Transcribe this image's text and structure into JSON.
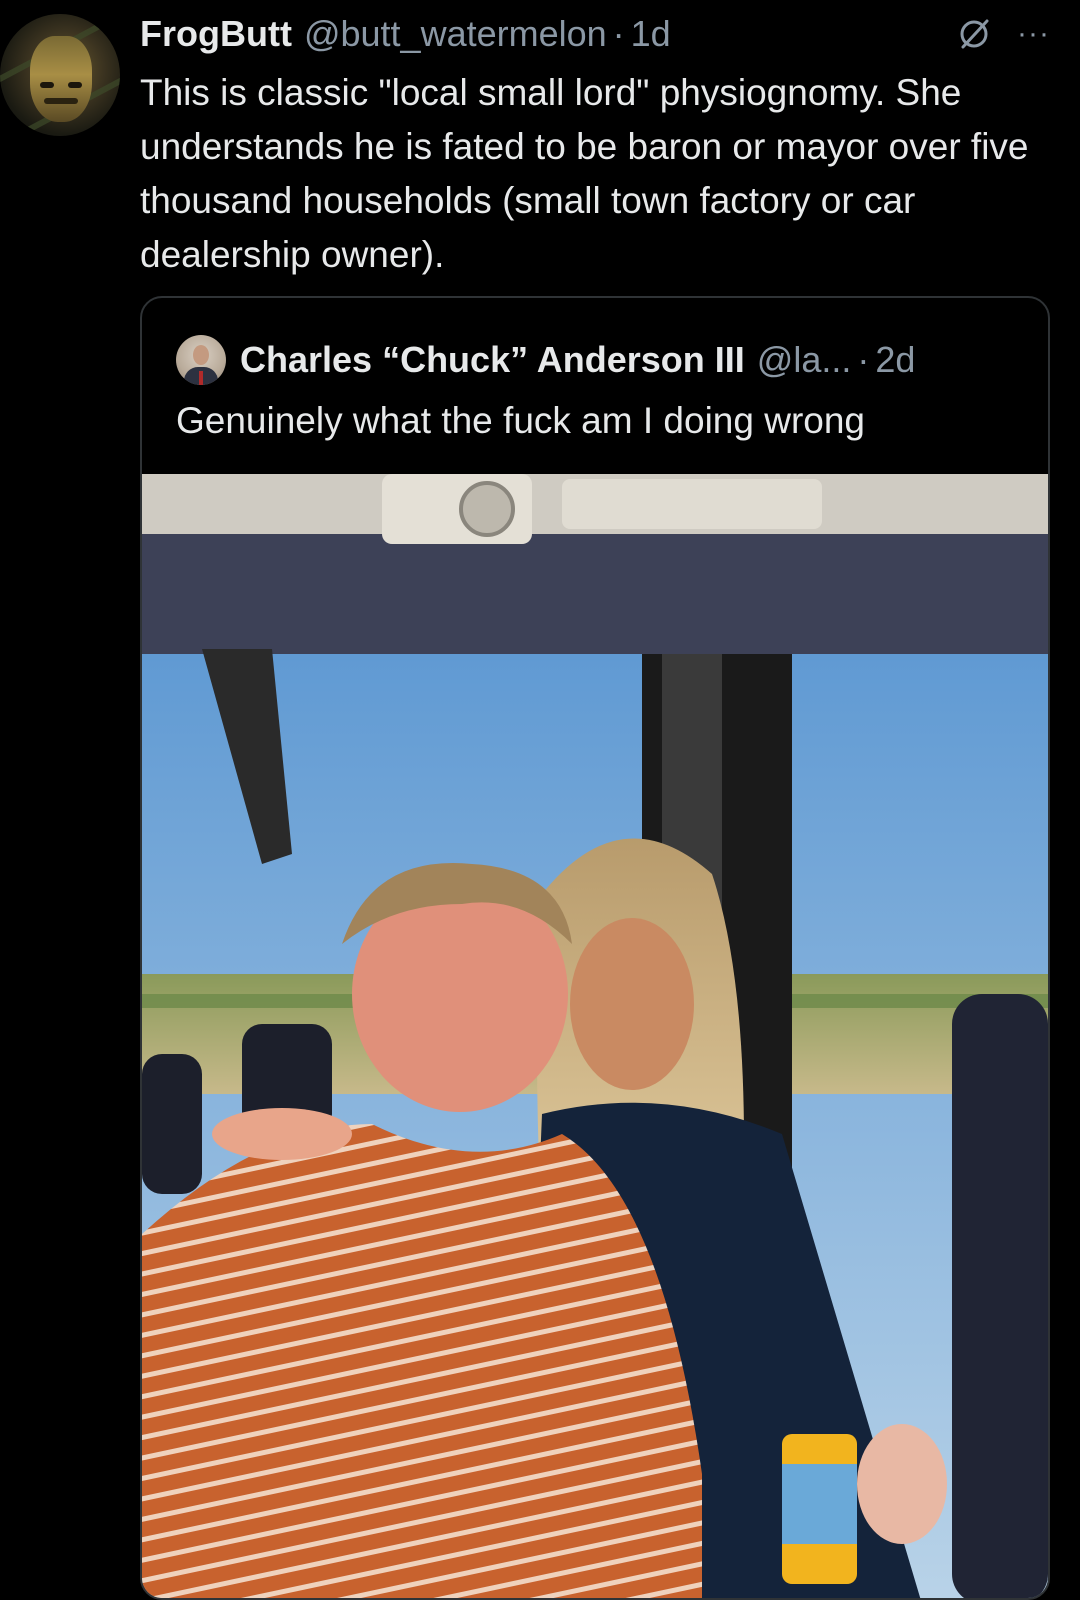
{
  "tweet": {
    "author_name": "FrogButt",
    "author_handle": "@butt_watermelon",
    "separator": "·",
    "time": "1d",
    "text": "This is classic \"local small lord\" physiognomy. She understands he is fated to be baron or mayor over five thousand households (small town factory or car dealership owner).",
    "avatar_icon": "profile-avatar",
    "grok_icon": "grok-icon",
    "more_icon": "more-options-icon",
    "more_glyph": "···"
  },
  "quoted_tweet": {
    "author_name": "Charles “Chuck” Anderson III",
    "author_handle": "@la...",
    "separator": "·",
    "time": "2d",
    "text": "Genuinely what the fuck am I doing wrong",
    "media_icon": "photo"
  },
  "colors": {
    "background": "#000000",
    "text_primary": "#e7e9ea",
    "text_secondary": "#8b98a5",
    "card_border": "#2f3336"
  }
}
